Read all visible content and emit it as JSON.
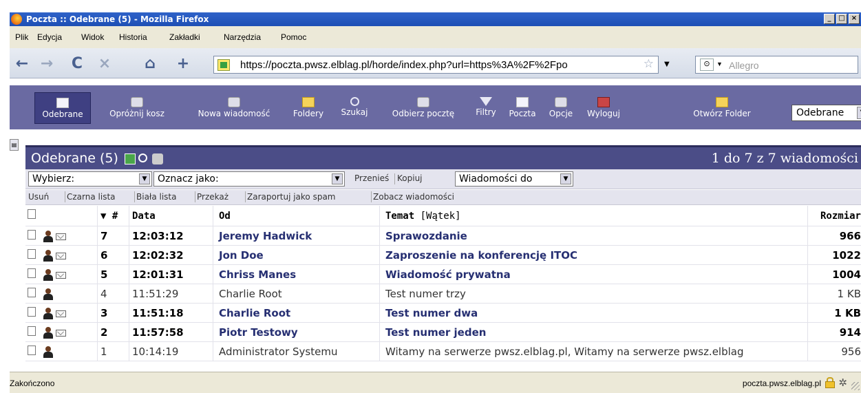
{
  "window": {
    "title": "Poczta :: Odebrane (5) - Mozilla Firefox",
    "buttons": [
      "_",
      "□",
      "×"
    ]
  },
  "menu": [
    "Plik",
    "Edycja",
    "Widok",
    "Historia",
    "Zakładki",
    "Narzędzia",
    "Pomoc"
  ],
  "nav": {
    "url": "https://poczta.pwsz.elblag.pl/horde/index.php?url=https%3A%2F%2Fpo",
    "search_placeholder": "Allegro"
  },
  "toolbar": {
    "inbox": "Odebrane",
    "empty_trash": "Opróżnij kosz",
    "new_message": "Nowa wiadomość",
    "folders": "Foldery",
    "search": "Szukaj",
    "get_mail": "Odbierz pocztę",
    "filters": "Filtry",
    "mail": "Poczta",
    "options": "Opcje",
    "logout": "Wyloguj",
    "open_folder": "Otwórz Folder",
    "folder_select": "Odebrane"
  },
  "mailbox": {
    "title": "Odebrane (5)",
    "range": "1 do 7 z 7 wiadomości"
  },
  "actions": {
    "select_label": "Wybierz:",
    "mark_label": "Oznacz jako:",
    "move": "Przenieś",
    "copy": "Kopiuj",
    "target": "Wiadomości do",
    "links": [
      "Usuń",
      "Czarna lista",
      "Biała lista",
      "Przekaż",
      "Zaraportuj jako spam",
      "Zobacz wiadomości"
    ]
  },
  "columns": {
    "num": "▼ #",
    "date": "Data",
    "from": "Od",
    "subject": "Temat",
    "thread": "[Wątek]",
    "size": "Rozmiar"
  },
  "messages": [
    {
      "num": "7",
      "date": "12:03:12",
      "from": "Jeremy Hadwick",
      "subject": "Sprawozdanie",
      "size": "966",
      "unread": true
    },
    {
      "num": "6",
      "date": "12:02:32",
      "from": "Jon Doe",
      "subject": "Zaproszenie na konferencję ITOC",
      "size": "1022",
      "unread": true
    },
    {
      "num": "5",
      "date": "12:01:31",
      "from": "Chriss Manes",
      "subject": "Wiadomość prywatna",
      "size": "1004",
      "unread": true
    },
    {
      "num": "4",
      "date": "11:51:29",
      "from": "Charlie Root",
      "subject": "Test numer trzy",
      "size": "1 KB",
      "unread": false
    },
    {
      "num": "3",
      "date": "11:51:18",
      "from": "Charlie Root",
      "subject": "Test numer dwa",
      "size": "1 KB",
      "unread": true
    },
    {
      "num": "2",
      "date": "11:57:58",
      "from": "Piotr Testowy",
      "subject": "Test numer jeden",
      "size": "914",
      "unread": true
    },
    {
      "num": "1",
      "date": "10:14:19",
      "from": "Administrator Systemu",
      "subject": "Witamy na serwerze pwsz.elblag.pl, Witamy na serwerze pwsz.elblag",
      "size": "956",
      "unread": false
    }
  ],
  "status": {
    "text": "Zakończono",
    "domain": "poczta.pwsz.elblag.pl"
  }
}
